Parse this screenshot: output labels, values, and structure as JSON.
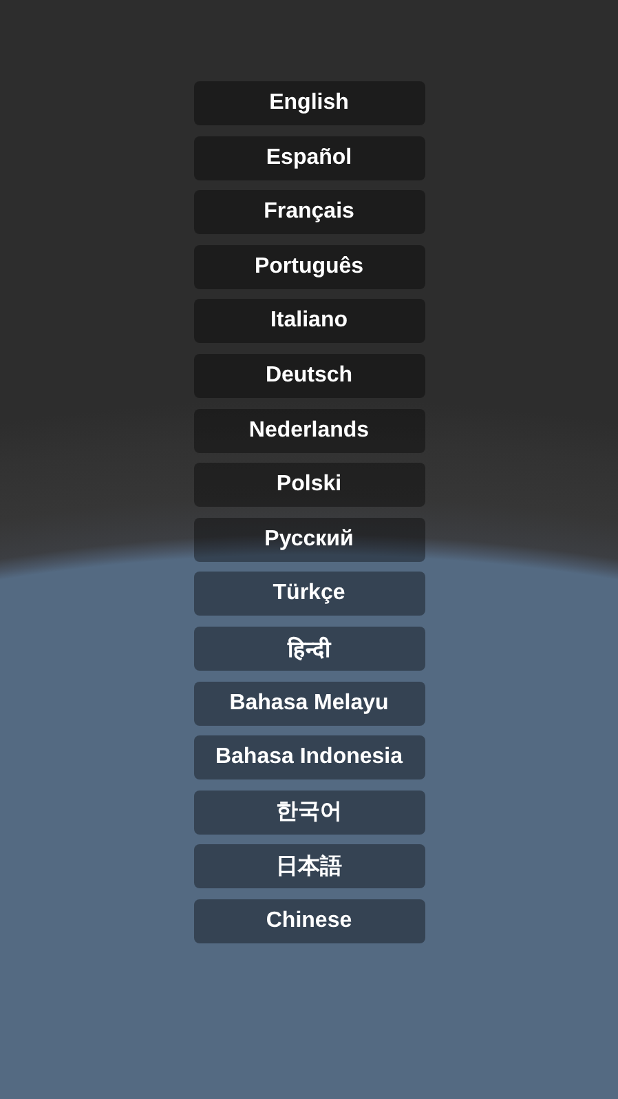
{
  "languages": [
    "English",
    "Español",
    "Français",
    "Português",
    "Italiano",
    "Deutsch",
    "Nederlands",
    "Polski",
    "Русский",
    "Türkçe",
    "हिन्दी",
    "Bahasa Melayu",
    "Bahasa Indonesia",
    "한국어",
    "日本語",
    "Chinese"
  ]
}
